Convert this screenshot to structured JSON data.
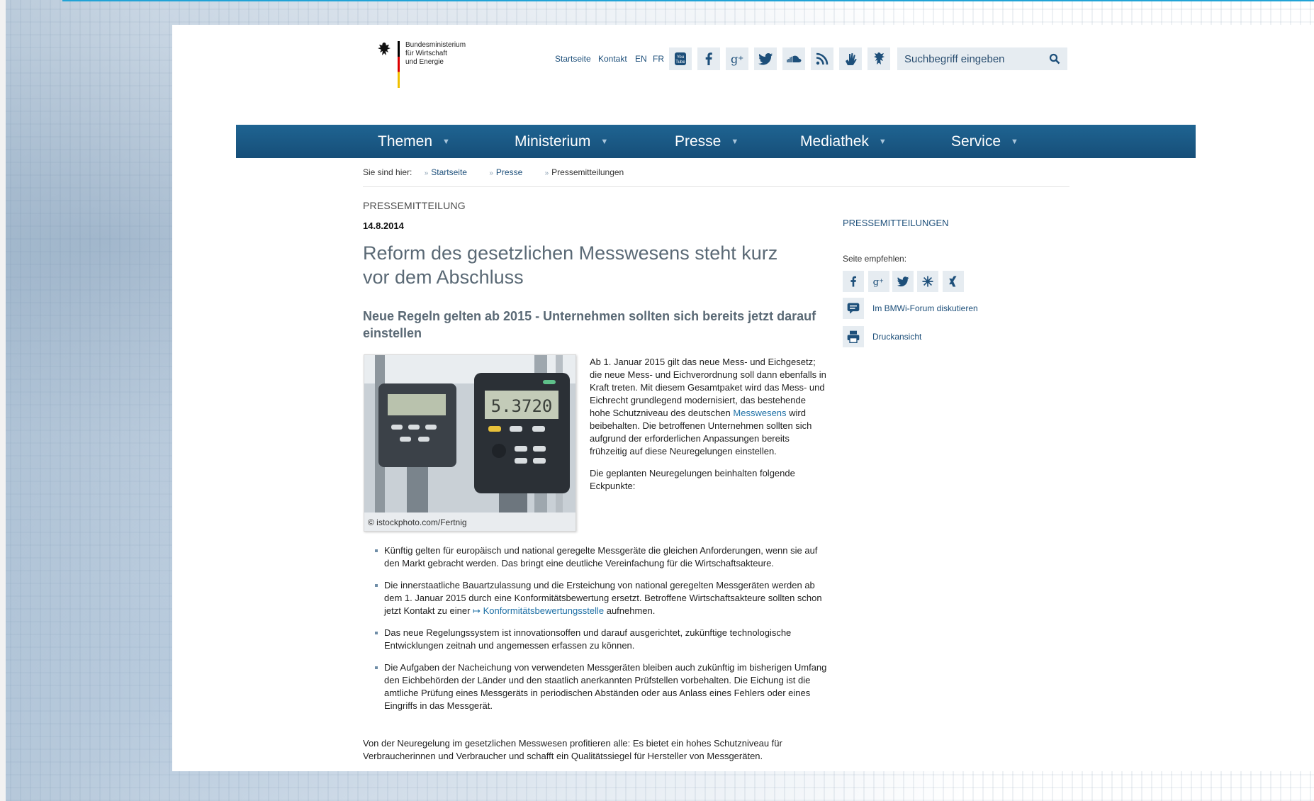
{
  "header": {
    "logo_lines": [
      "Bundesministerium",
      "für Wirtschaft",
      "und Energie"
    ],
    "top_links": [
      "Startseite",
      "Kontakt",
      "EN",
      "FR"
    ],
    "social_icons": [
      "youtube-icon",
      "facebook-icon",
      "google-plus-icon",
      "twitter-icon",
      "soundcloud-icon",
      "rss-icon",
      "hand-icon",
      "eagle-icon"
    ],
    "youtube_label": "You Tube",
    "search_placeholder": "Suchbegriff eingeben"
  },
  "nav": {
    "items": [
      "Themen",
      "Ministerium",
      "Presse",
      "Mediathek",
      "Service"
    ]
  },
  "breadcrumb": {
    "prefix": "Sie sind hier:",
    "items": [
      "Startseite",
      "Presse",
      "Pressemitteilungen"
    ]
  },
  "article": {
    "kicker": "PRESSEMITTEILUNG",
    "date": "14.8.2014",
    "title": "Reform des gesetzlichen Messwesens steht kurz vor dem Abschluss",
    "subtitle": "Neue Regeln gelten ab 2015 - Unternehmen sollten sich bereits jetzt darauf einstellen",
    "image_caption": "© istockphoto.com/Fertnig",
    "image_display": "5.3720",
    "p1_before": "Ab 1. Januar 2015 gilt das neue Mess- und Eichgesetz; die neue Mess- und Eichverordnung soll dann ebenfalls in Kraft treten. Mit diesem Gesamtpaket wird das Mess- und Eichrecht grundlegend modernisiert, das bestehende hohe Schutzniveau des deutschen",
    "p1_link": "Messwesens",
    "p1_after": "wird beibehalten. Die betroffenen Unternehmen sollten sich aufgrund der erforderlichen Anpassungen bereits frühzeitig auf diese Neuregelungen einstellen.",
    "p2": "Die geplanten Neuregelungen beinhalten folgende Eckpunkte:",
    "bullet1": "Künftig gelten für europäisch und national geregelte Messgeräte die gleichen Anforderungen, wenn sie auf den Markt gebracht werden. Das bringt eine deutliche Vereinfachung für die Wirtschaftsakteure.",
    "bullet2_before": "Die innerstaatliche Bauartzulassung und die Ersteichung von national geregelten Messgeräten werden ab dem 1. Januar 2015 durch eine Konformitätsbewertung ersetzt. Betroffene Wirtschaftsakteure sollten schon jetzt Kontakt zu einer",
    "bullet2_link": "Konformitätsbewertungsstelle",
    "bullet2_after": "aufnehmen.",
    "bullet3": "Das neue Regelungssystem ist innovationsoffen und darauf ausgerichtet, zukünftige technologische Entwicklungen zeitnah und angemessen erfassen zu können.",
    "bullet4": "Die Aufgaben der Nacheichung von verwendeten Messgeräten bleiben auch zukünftig im bisherigen Umfang den Eichbehörden der Länder und den staatlich anerkannten Prüfstellen vorbehalten. Die Eichung ist die amtliche Prüfung eines Messgeräts in periodischen Abständen oder aus Anlass eines Fehlers oder eines Eingriffs in das Messgerät.",
    "closing": "Von der Neuregelung im gesetzlichen Messwesen profitieren alle: Es bietet ein hohes Schutzniveau für Verbraucherinnen und Verbraucher und schafft ein Qualitätssiegel für Hersteller von Messgeräten."
  },
  "sidebar": {
    "heading": "PRESSEMITTEILUNGEN",
    "recommend": "Seite empfehlen:",
    "share_icons": [
      "facebook-icon",
      "google-plus-icon",
      "twitter-icon",
      "delicious-icon",
      "xing-icon"
    ],
    "forum": "Im BMWi-Forum diskutieren",
    "print": "Druckansicht"
  },
  "colors": {
    "nav": "#1f6492",
    "link": "#1d6fa5",
    "accent_line": "#21a3d6",
    "title": "#5a6975"
  }
}
